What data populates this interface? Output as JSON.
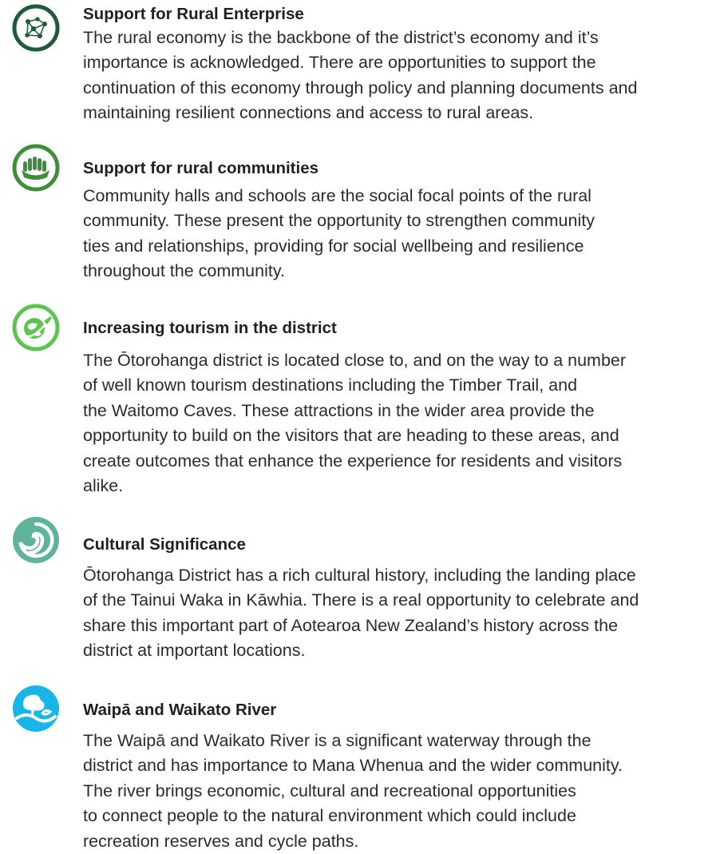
{
  "sections": [
    {
      "icon": "network-icon",
      "title": "Support for Rural Enterprise",
      "lines": [
        "The rural economy is the backbone of the district’s economy and it’s",
        "importance is acknowledged. There are opportunities to support the",
        "continuation of this economy through policy and planning documents and",
        "maintaining resilient connections and access to rural areas."
      ]
    },
    {
      "icon": "joined-hands-icon",
      "title": "Support for rural communities",
      "lines": [
        "Community halls and schools are the social focal points of the rural",
        "community. These present the opportunity to strengthen community",
        "ties and relationships, providing for social wellbeing and resilience",
        "throughout the community."
      ]
    },
    {
      "icon": "globe-plane-icon",
      "title": "Increasing tourism in the district",
      "lines": [
        "The Ōtorohanga district is located close to, and on the way to a number",
        "of well known tourism destinations including the Timber Trail, and",
        "the Waitomo Caves. These attractions in the wider area provide the",
        "opportunity to build on the visitors that are heading to these areas, and",
        "create outcomes that enhance the experience for residents and visitors",
        "alike."
      ]
    },
    {
      "icon": "koru-icon",
      "title": "Cultural Significance",
      "lines": [
        "Ōtorohanga District has a rich cultural history, including the landing place",
        "of the Tainui Waka in Kāwhia. There is a real opportunity to celebrate and",
        "share this important part of Aotearoa New Zealand’s history across the",
        "district at important locations."
      ]
    },
    {
      "icon": "tree-river-icon",
      "title": "Waipā and Waikato River",
      "lines": [
        "The Waipā and Waikato River is a significant waterway through the",
        "district and has importance to Mana Whenua and the wider community.",
        "The river brings economic, cultural and recreational opportunities",
        "to connect people to the natural environment which could include",
        "recreation reserves and cycle paths."
      ]
    }
  ],
  "colors": {
    "dark_green": "#1f5b3a",
    "mid_green": "#3f8f3a",
    "light_green": "#5dc44f",
    "sea_green": "#5fb39a",
    "cyan": "#17b5e8",
    "text": "#231f20"
  }
}
